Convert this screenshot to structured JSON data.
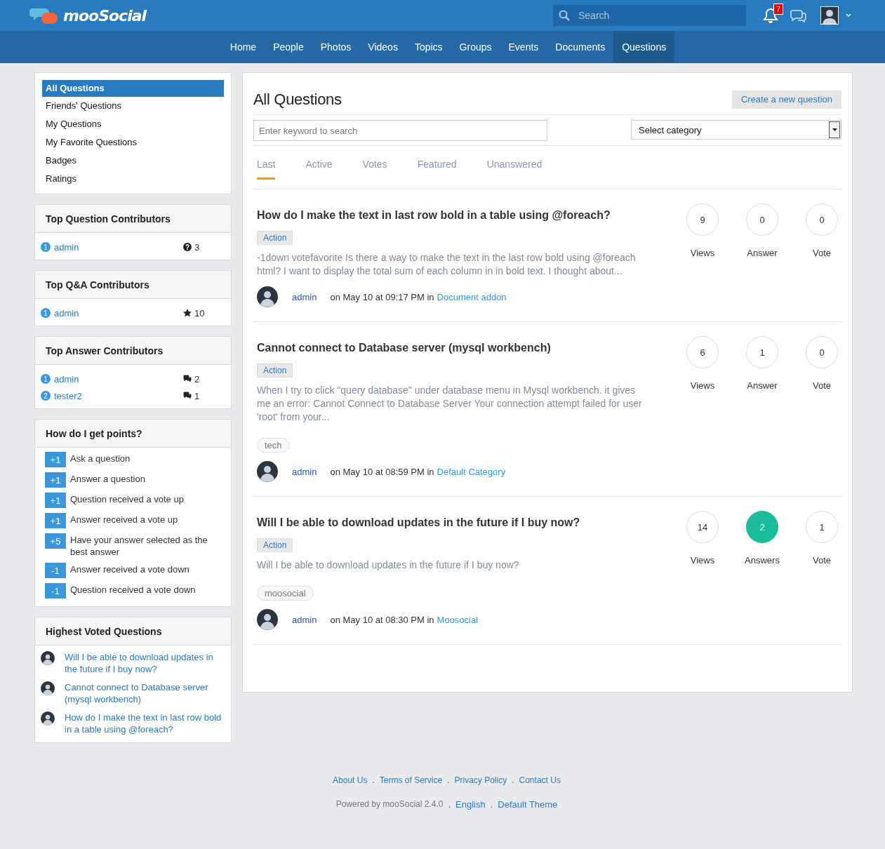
{
  "header": {
    "brand": "mooSocial",
    "search": {
      "placeholder": "Search"
    },
    "notification_count": "7"
  },
  "nav": [
    {
      "label": "Home",
      "selected": false
    },
    {
      "label": "People",
      "selected": false
    },
    {
      "label": "Photos",
      "selected": false
    },
    {
      "label": "Videos",
      "selected": false
    },
    {
      "label": "Topics",
      "selected": false
    },
    {
      "label": "Groups",
      "selected": false
    },
    {
      "label": "Events",
      "selected": false
    },
    {
      "label": "Documents",
      "selected": false
    },
    {
      "label": "Questions",
      "selected": true
    }
  ],
  "sidebar_menu": [
    {
      "label": "All Questions",
      "selected": true
    },
    {
      "label": "Friends' Questions",
      "selected": false
    },
    {
      "label": "My Questions",
      "selected": false
    },
    {
      "label": "My Favorite Questions",
      "selected": false
    },
    {
      "label": "Badges",
      "selected": false
    },
    {
      "label": "Ratings",
      "selected": false
    }
  ],
  "panels": [
    {
      "kind": "question-contributors",
      "title": "Top Question Contributors",
      "rows": [
        {
          "rank": "1",
          "name": "admin",
          "count": "3"
        }
      ]
    },
    {
      "kind": "qa-contributors",
      "title": "Top Q&A Contributors",
      "rows": [
        {
          "rank": "1",
          "name": "admin",
          "count": "10"
        }
      ]
    },
    {
      "kind": "answer-contributors",
      "title": "Top Answer Contributors",
      "rows": [
        {
          "rank": "1",
          "name": "admin",
          "count": "2"
        },
        {
          "rank": "2",
          "name": "tester2",
          "count": "1"
        }
      ]
    },
    {
      "kind": "points",
      "title": "How do I get points?",
      "rows": [
        {
          "points": "+1",
          "text": "Ask a question"
        },
        {
          "points": "+1",
          "text": "Answer a question"
        },
        {
          "points": "+1",
          "text": "Question received a vote up"
        },
        {
          "points": "+1",
          "text": "Answer received a vote up"
        },
        {
          "points": "+5",
          "text": "Have your answer selected as the best answer"
        },
        {
          "points": "-1",
          "text": "Answer received a vote down"
        },
        {
          "points": "-1",
          "text": "Question received a vote down"
        }
      ]
    },
    {
      "kind": "questions",
      "title": "Highest Voted Questions",
      "rows": [
        {
          "text": "Will I be able to download updates in the future if I buy now?"
        },
        {
          "text": "Cannot connect to Database server (mysql workbench)"
        },
        {
          "text": "How do I make the text in last row bold in a table using @foreach?"
        }
      ]
    }
  ],
  "main": {
    "title": "All Questions",
    "create_button": "Create a new question",
    "keyword_search": {
      "placeholder": "Enter keyword to search"
    },
    "category_select": {
      "value": "Select category"
    },
    "tabs": [
      {
        "label": "Last",
        "selected": true
      },
      {
        "label": "Active",
        "selected": false
      },
      {
        "label": "Votes",
        "selected": false
      },
      {
        "label": "Featured",
        "selected": false
      },
      {
        "label": "Unanswered",
        "selected": false
      }
    ],
    "questions": [
      {
        "title": "How do I make the text in last row bold in a table using @foreach?",
        "label": "Action",
        "excerpt": "-1down votefavorite Is there a way to make the text in the last row bold using @foreach html? I want to display the total sum of each column in in bold text. I thought about...",
        "author": "admin",
        "posted": "on May 10 at 09:17 PM in",
        "category": "Document addon",
        "stats": [
          {
            "value": "9",
            "label": "Views",
            "highlighted": false
          },
          {
            "value": "0",
            "label": "Answer",
            "highlighted": false
          },
          {
            "value": "0",
            "label": "Vote",
            "highlighted": false
          }
        ]
      },
      {
        "title": "Cannot connect to Database server (mysql workbench)",
        "label": "Action",
        "excerpt": "When I try to click \"query database\" under database menu in Mysql workbench. it gives me an error: Cannot Connect to Database Server Your connection attempt failed for user 'root' from your...",
        "tags": [
          "tech"
        ],
        "author": "admin",
        "posted": "on May 10 at 08:59 PM in",
        "category": "Default Category",
        "stats": [
          {
            "value": "6",
            "label": "Views",
            "highlighted": false
          },
          {
            "value": "1",
            "label": "Answer",
            "highlighted": false
          },
          {
            "value": "0",
            "label": "Vote",
            "highlighted": false
          }
        ]
      },
      {
        "title": "Will I be able to download updates in the future if I buy now?",
        "label": "Action",
        "excerpt": "Will I be able to download updates in the future if I buy now?",
        "tags": [
          "moosocial"
        ],
        "author": "admin",
        "posted": "on May 10 at 08:30 PM in",
        "category": "Moosocial",
        "stats": [
          {
            "value": "14",
            "label": "Views",
            "highlighted": false
          },
          {
            "value": "2",
            "label": "Answers",
            "highlighted": true
          },
          {
            "value": "1",
            "label": "Vote",
            "highlighted": false
          }
        ]
      }
    ]
  },
  "footer": {
    "separator": ".",
    "links": [
      "About Us",
      "Terms of Service",
      "Privacy Policy",
      "Contact Us"
    ],
    "powered_by": "Powered by mooSocial 2.4.0",
    "language": "English",
    "theme": "Default Theme"
  }
}
